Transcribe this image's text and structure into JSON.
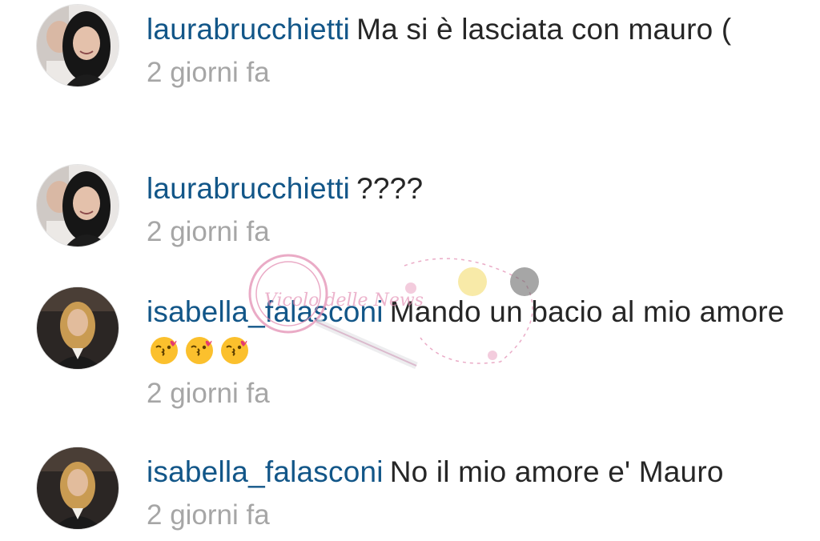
{
  "comments": [
    {
      "username": "laurabrucchietti",
      "text": "Ma si è  lasciata con mauro (",
      "time": "2 giorni fa",
      "avatar": "avatar-woman-dark-hair"
    },
    {
      "username": "laurabrucchietti",
      "text": "????",
      "time": "2 giorni fa",
      "avatar": "avatar-woman-dark-hair"
    },
    {
      "username": "isabella_falasconi",
      "text": "Mando un bacio al mio amore",
      "time": "2 giorni fa",
      "avatar": "avatar-woman-blonde",
      "emojis": [
        "kiss-emoji",
        "kiss-emoji",
        "kiss-emoji"
      ]
    },
    {
      "username": "isabella_falasconi",
      "text": "No il mio amore e' Mauro",
      "time": "2 giorni fa",
      "avatar": "avatar-woman-blonde"
    }
  ],
  "colors": {
    "username": "#125688",
    "text": "#262626",
    "time": "#a6a6a6",
    "watermark": "#e48fb4"
  },
  "watermark": {
    "logo_text": "Vicolo delle News"
  }
}
